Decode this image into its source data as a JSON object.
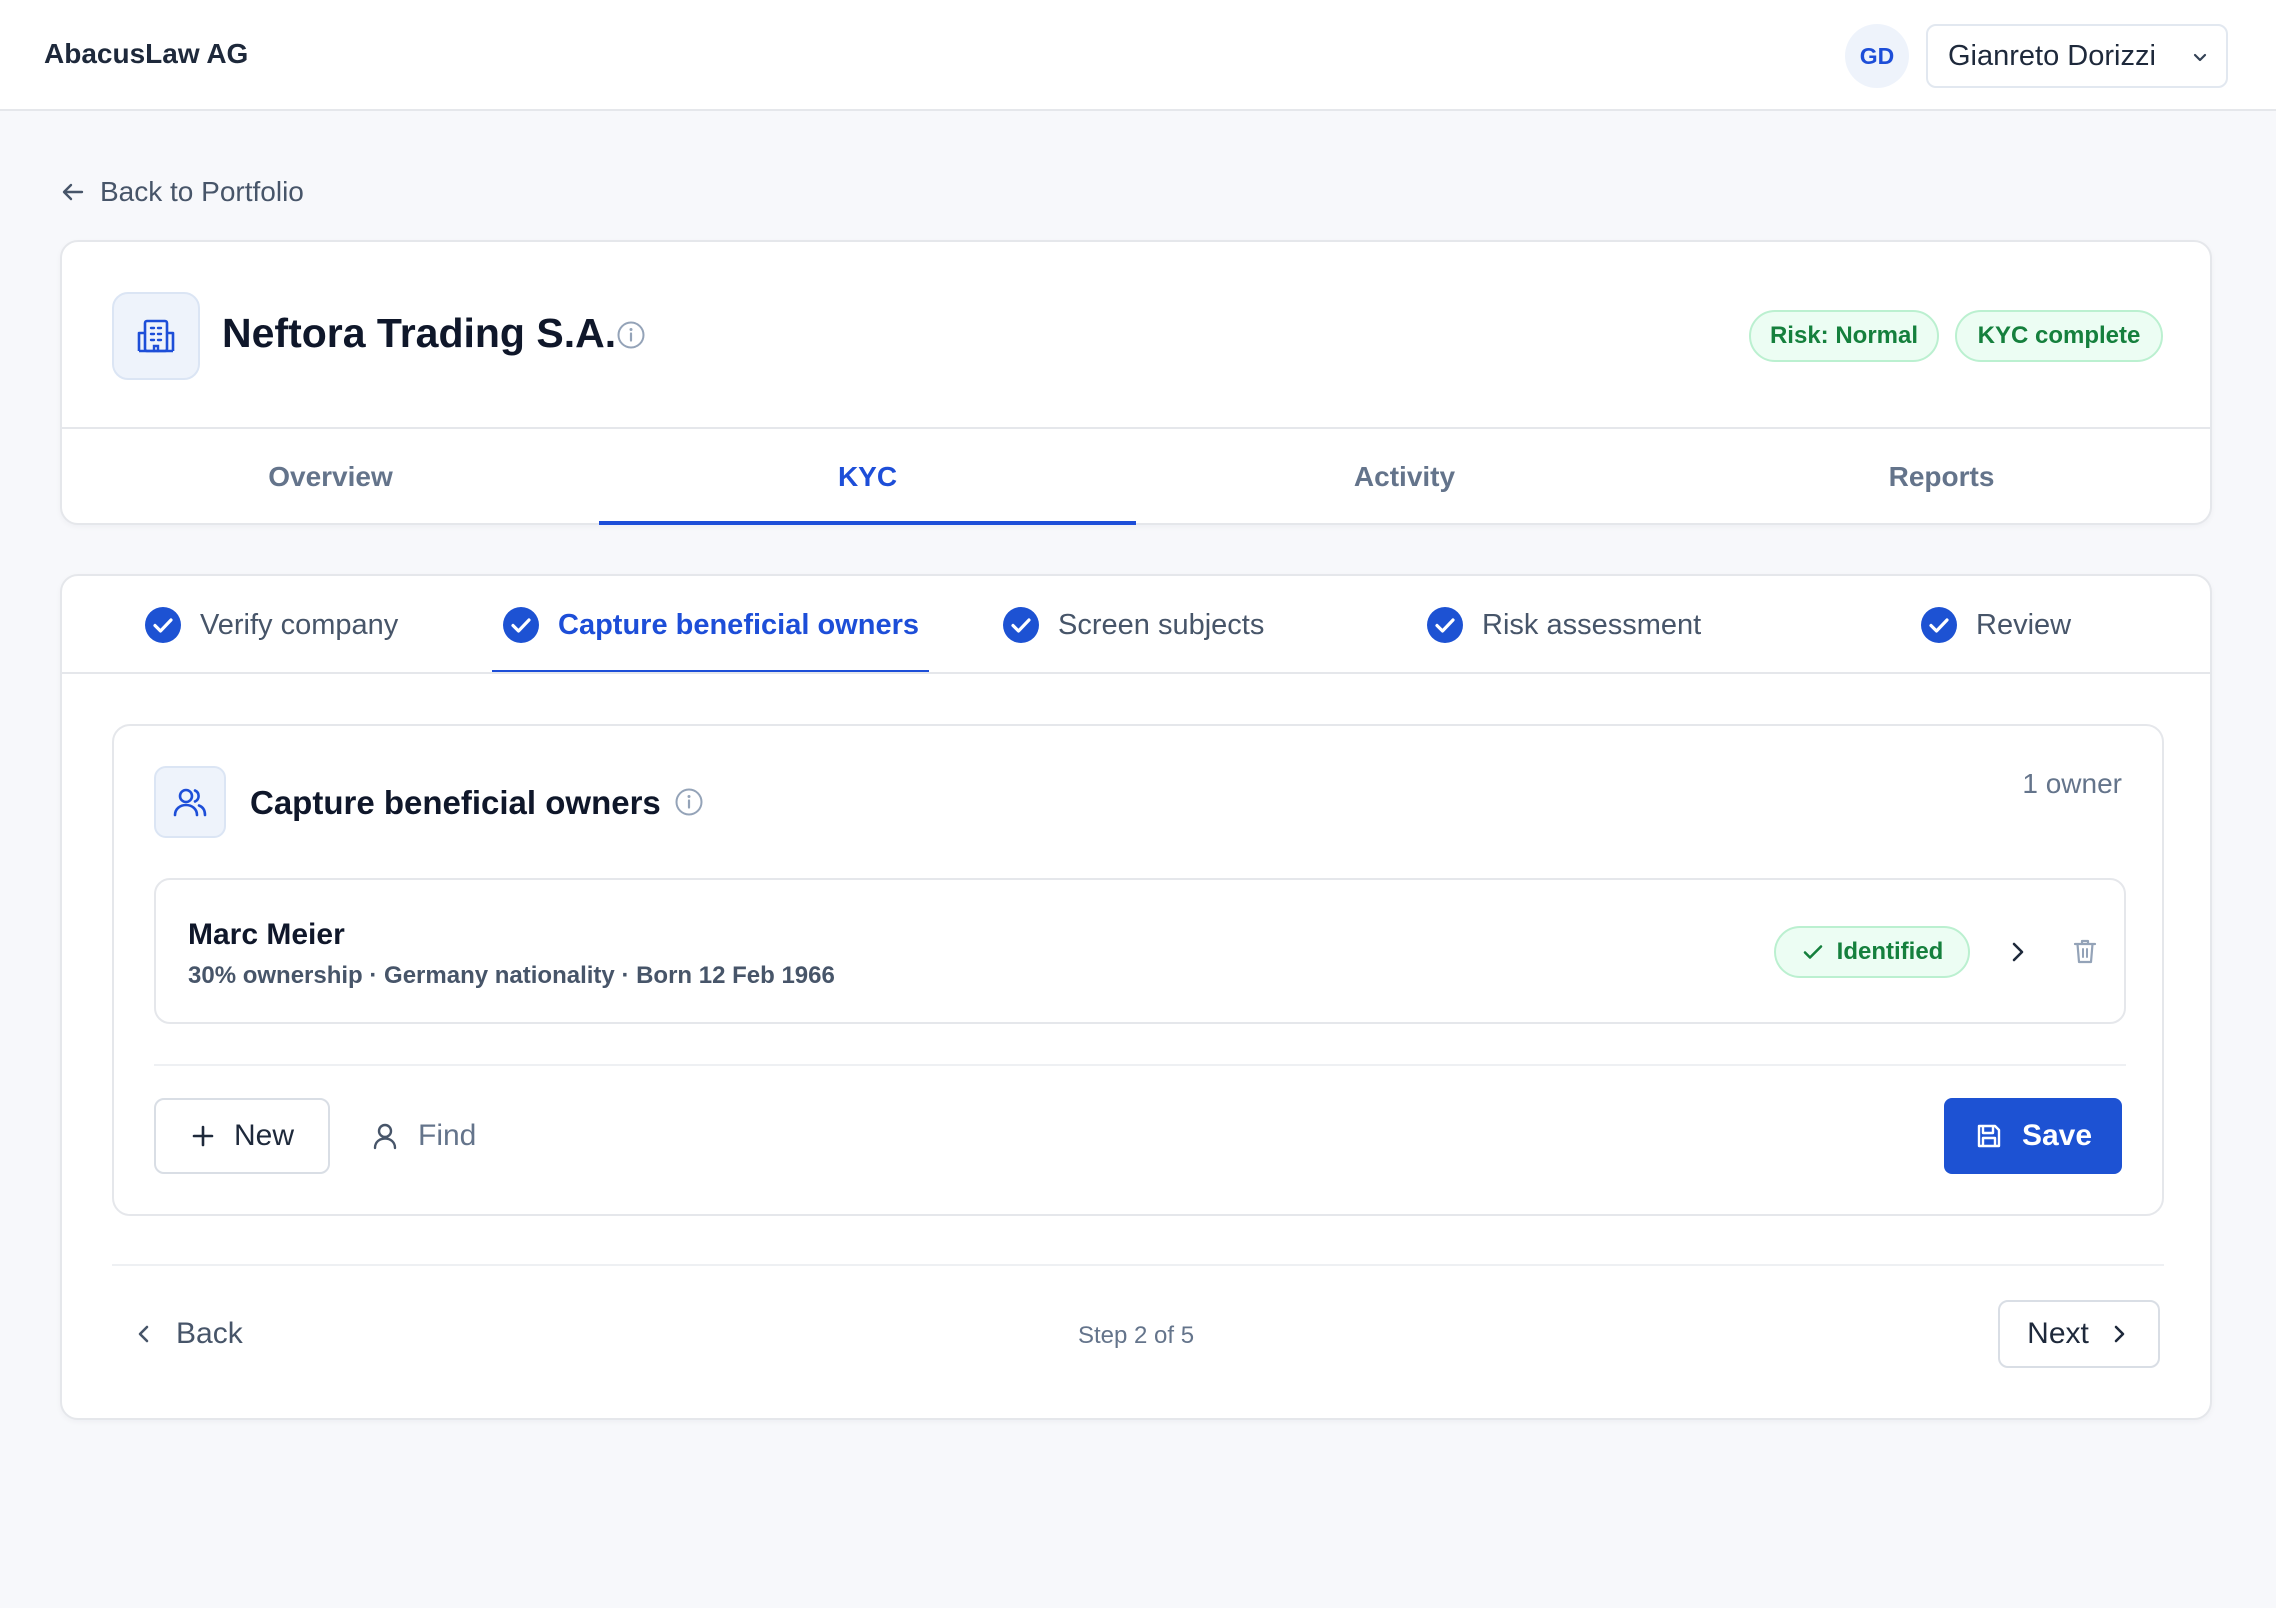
{
  "app": {
    "brand": "AbacusLaw AG",
    "user_initials": "GD",
    "user_name": "Gianreto Dorizzi"
  },
  "nav": {
    "back_label": "Back to Portfolio"
  },
  "company": {
    "name": "Neftora Trading S.A.",
    "badges": {
      "risk": "Risk: Normal",
      "kyc": "KYC complete"
    },
    "tabs": [
      {
        "label": "Overview",
        "active": false
      },
      {
        "label": "KYC",
        "active": true
      },
      {
        "label": "Activity",
        "active": false
      },
      {
        "label": "Reports",
        "active": false
      }
    ]
  },
  "wizard": {
    "steps": [
      {
        "label": "Verify company",
        "completed": true,
        "active": false
      },
      {
        "label": "Capture beneficial owners",
        "completed": true,
        "active": true
      },
      {
        "label": "Screen subjects",
        "completed": true,
        "active": false
      },
      {
        "label": "Risk assessment",
        "completed": true,
        "active": false
      },
      {
        "label": "Review",
        "completed": true,
        "active": false
      }
    ],
    "section": {
      "title": "Capture beneficial owners",
      "owner_count": "1 owner",
      "owners": [
        {
          "name": "Marc Meier",
          "meta": "30% ownership · Germany nationality · Born 12 Feb 1966",
          "status": "Identified"
        }
      ]
    },
    "actions": {
      "new_label": "New",
      "find_label": "Find",
      "save_label": "Save"
    },
    "footer": {
      "back_label": "Back",
      "step_indicator": "Step 2 of 5",
      "next_label": "Next"
    }
  },
  "colors": {
    "accent": "#1d4ed8",
    "success_text": "#15803d",
    "success_bg": "#ecfdf3",
    "page_bg": "#f7f8fb"
  }
}
